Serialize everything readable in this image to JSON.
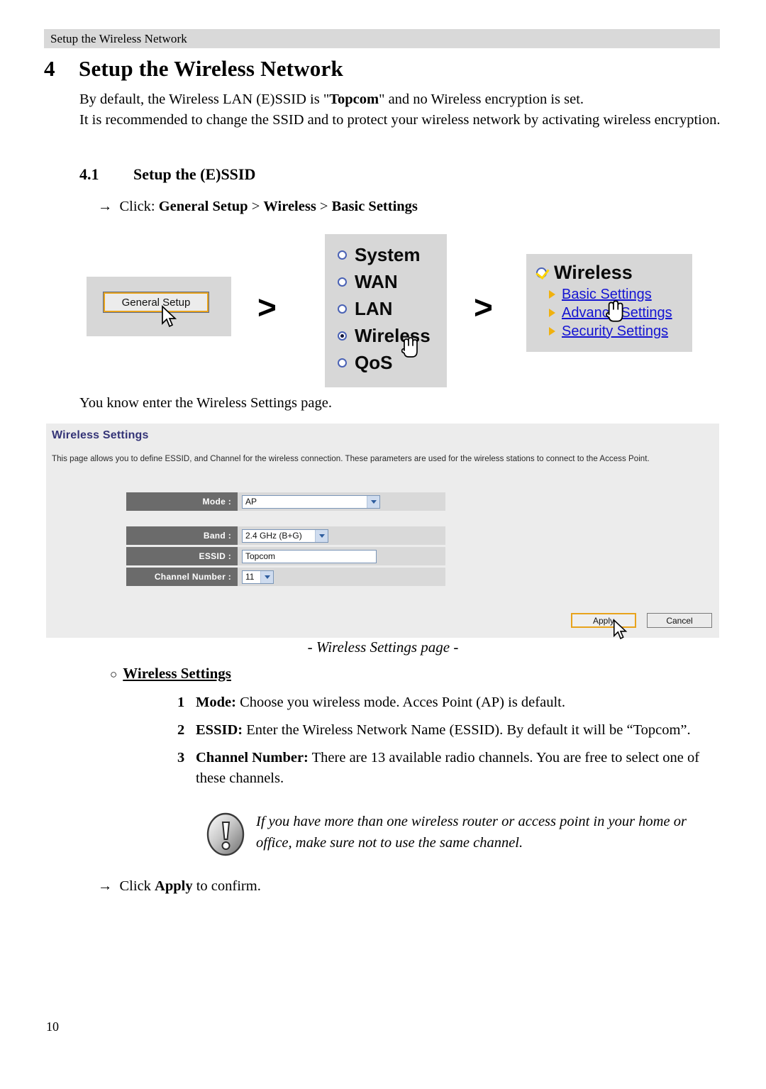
{
  "header": {
    "running_title": "Setup the Wireless Network"
  },
  "chapter": {
    "number": "4",
    "title": "Setup the Wireless Network"
  },
  "intro": {
    "line1_a": "By default, the Wireless LAN (E)SSID is \"",
    "line1_b": "Topcom",
    "line1_c": "\" and no Wireless encryption is set.",
    "line2": "It is recommended to change the SSID and to protect your wireless network by activating wireless encryption."
  },
  "section": {
    "number": "4.1",
    "title": "Setup the (E)SSID"
  },
  "click_instruction": {
    "arrow": "→",
    "prefix": "Click:",
    "step1": "General Setup",
    "sep1": ">",
    "step2": "Wireless",
    "sep2": ">",
    "step3": "Basic Settings"
  },
  "nav_diagram": {
    "general_setup_button": "General Setup",
    "chevron": ">",
    "radio_items": [
      {
        "label": "System",
        "selected": false
      },
      {
        "label": "WAN",
        "selected": false
      },
      {
        "label": "LAN",
        "selected": false
      },
      {
        "label": "Wireless",
        "selected": true
      },
      {
        "label": "QoS",
        "selected": false
      }
    ],
    "wireless_menu": {
      "title": "Wireless",
      "links": [
        "Basic Settings",
        "Advance Settings",
        "Security Settings"
      ]
    }
  },
  "sentence_after_diagram": "You know enter the Wireless Settings page.",
  "wireless_settings_panel": {
    "title": "Wireless Settings",
    "description": "This page allows you to define ESSID, and Channel for the wireless connection. These parameters are used for the wireless stations to connect to the Access Point.",
    "fields": [
      {
        "label": "Mode :",
        "value": "AP",
        "type": "select"
      },
      {
        "label": "Band :",
        "value": "2.4 GHz (B+G)",
        "type": "select"
      },
      {
        "label": "ESSID :",
        "value": "Topcom",
        "type": "text"
      },
      {
        "label": "Channel Number :",
        "value": "11",
        "type": "select"
      }
    ],
    "apply_button": "Apply",
    "cancel_button": "Cancel",
    "title_color": "#343477",
    "label_bg": "#6b6b6b",
    "highlight_color": "#e8a31c"
  },
  "caption": "- Wireless Settings page -",
  "bullet_heading": {
    "marker": "○",
    "text": "Wireless Settings"
  },
  "numbered_list": [
    {
      "n": "1",
      "bold": "Mode:",
      "rest": " Choose you wireless mode. Acces Point (AP) is default."
    },
    {
      "n": "2",
      "bold": "ESSID:",
      "rest": " Enter the Wireless Network Name (ESSID). By default it will be “Topcom”."
    },
    {
      "n": "3",
      "bold": "Channel Number:",
      "rest": " There are 13 available radio channels. You are free to select one of these channels."
    }
  ],
  "note": {
    "icon": "exclamation-icon",
    "text": "If you have more than one wireless router or access point in your home or office, make sure not to use the same channel."
  },
  "final_instruction": {
    "arrow": "→",
    "prefix": "Click ",
    "bold": "Apply",
    "suffix": " to confirm."
  },
  "page_number": "10"
}
